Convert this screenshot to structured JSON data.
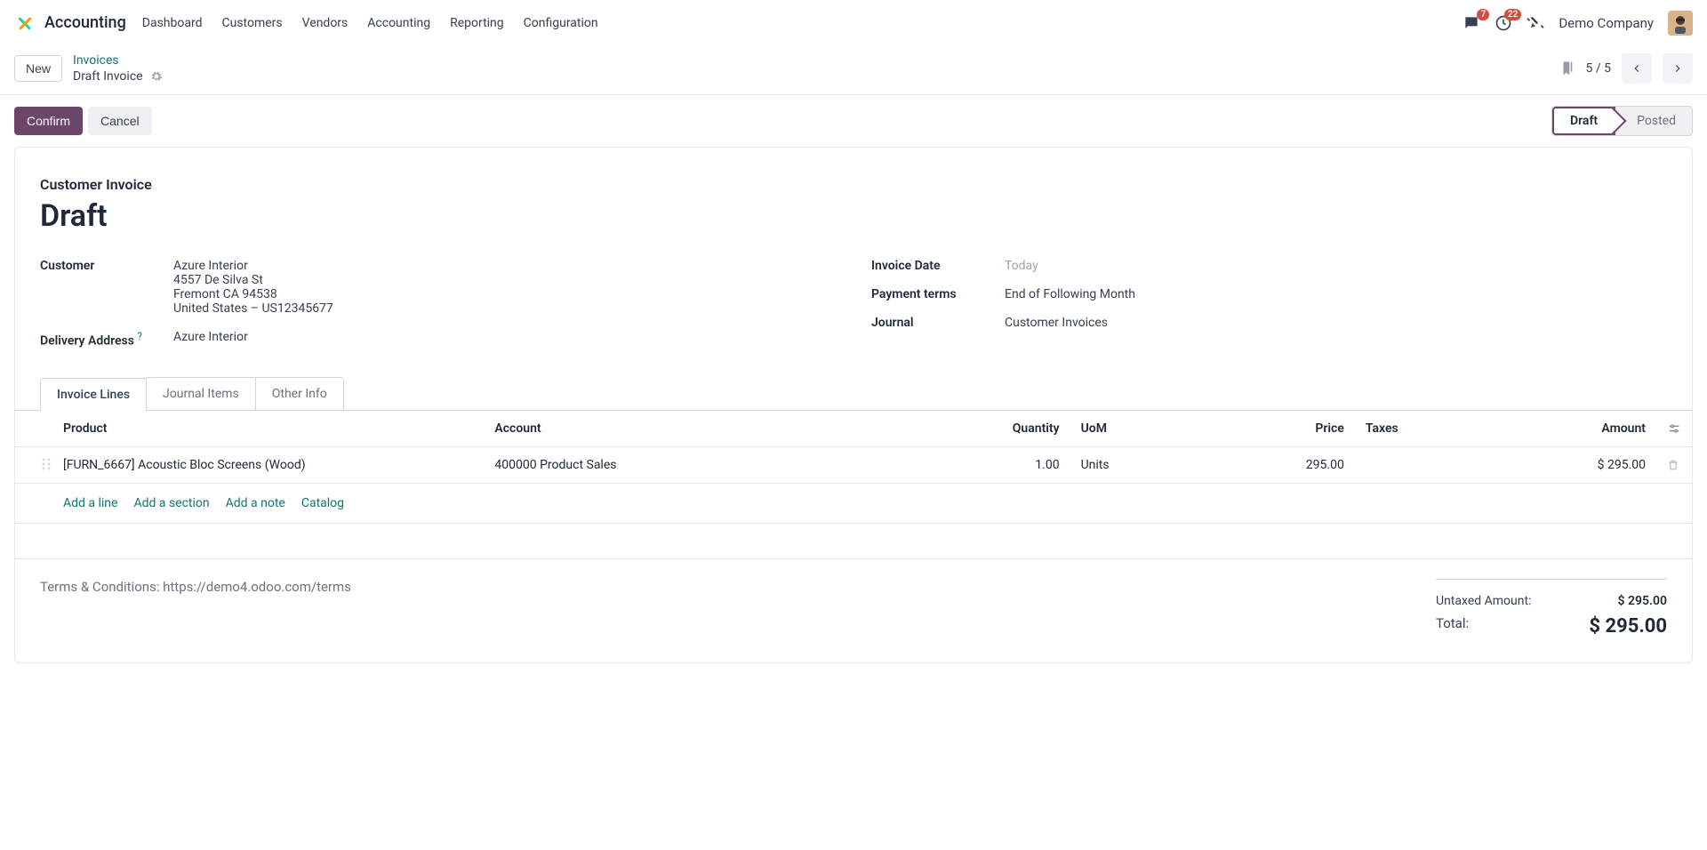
{
  "nav": {
    "app": "Accounting",
    "items": [
      "Dashboard",
      "Customers",
      "Vendors",
      "Accounting",
      "Reporting",
      "Configuration"
    ],
    "chat_badge": "7",
    "activity_badge": "22",
    "company": "Demo Company"
  },
  "controlbar": {
    "new_label": "New",
    "breadcrumb_parent": "Invoices",
    "breadcrumb_current": "Draft Invoice",
    "pager": "5 / 5"
  },
  "actions": {
    "confirm": "Confirm",
    "cancel": "Cancel",
    "status_active": "Draft",
    "status_inactive": "Posted"
  },
  "doc": {
    "type": "Customer Invoice",
    "title": "Draft",
    "customer_label": "Customer",
    "customer_name": "Azure Interior",
    "customer_addr1": "4557 De Silva St",
    "customer_addr2": "Fremont CA 94538",
    "customer_addr3": "United States – US12345677",
    "delivery_label": "Delivery Address",
    "delivery_value": "Azure Interior",
    "invoice_date_label": "Invoice Date",
    "invoice_date_value": "Today",
    "payment_terms_label": "Payment terms",
    "payment_terms_value": "End of Following Month",
    "journal_label": "Journal",
    "journal_value": "Customer Invoices"
  },
  "tabs": [
    "Invoice Lines",
    "Journal Items",
    "Other Info"
  ],
  "table": {
    "headers": {
      "product": "Product",
      "account": "Account",
      "quantity": "Quantity",
      "uom": "UoM",
      "price": "Price",
      "taxes": "Taxes",
      "amount": "Amount"
    },
    "row": {
      "product": "[FURN_6667] Acoustic Bloc Screens (Wood)",
      "account": "400000 Product Sales",
      "quantity": "1.00",
      "uom": "Units",
      "price": "295.00",
      "taxes": "",
      "amount": "$ 295.00"
    },
    "add_line": "Add a line",
    "add_section": "Add a section",
    "add_note": "Add a note",
    "catalog": "Catalog"
  },
  "footer": {
    "terms": "Terms & Conditions: https://demo4.odoo.com/terms",
    "untaxed_label": "Untaxed Amount:",
    "untaxed_value": "$ 295.00",
    "total_label": "Total:",
    "total_value": "$ 295.00"
  }
}
